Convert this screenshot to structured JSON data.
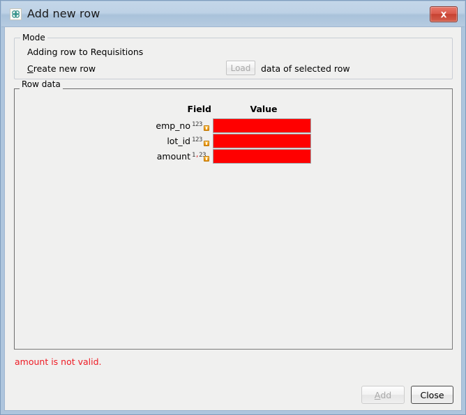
{
  "window": {
    "title": "Add new row",
    "icon": "app-flower-icon",
    "close_label": "Close window"
  },
  "mode": {
    "legend": "Mode",
    "status_text": "Adding row to Requisitions",
    "create_label_mnemonic": "C",
    "create_label_rest": "reate new row",
    "load_button": "Load",
    "load_suffix": "data of selected row"
  },
  "row_data": {
    "legend": "Row data",
    "headers": {
      "field": "Field",
      "value": "Value"
    },
    "rows": [
      {
        "field": "emp_no",
        "type_icon": "integer-type-icon",
        "type_glyph": "123",
        "value": "",
        "invalid": true
      },
      {
        "field": "lot_id",
        "type_icon": "integer-type-icon",
        "type_glyph": "123",
        "value": "",
        "invalid": true
      },
      {
        "field": "amount",
        "type_icon": "decimal-type-icon",
        "type_glyph": "1,23",
        "value": "",
        "invalid": true
      }
    ]
  },
  "error": {
    "message": "amount is not valid."
  },
  "footer": {
    "add_mnemonic": "A",
    "add_rest": "dd",
    "add_label": "Add",
    "close_label": "Close"
  },
  "colors": {
    "invalid_field": "#ff0000",
    "error_text": "#ee1b24",
    "titlebar_top": "#c4d6e8",
    "titlebar_bottom": "#b6cbe1",
    "close_button": "#c64232",
    "dialog_background": "#f0f0ef",
    "type_badge": "#f6a623"
  }
}
